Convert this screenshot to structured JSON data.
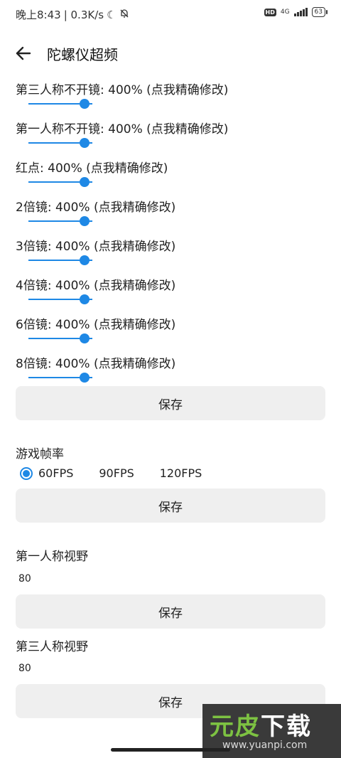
{
  "status": {
    "time": "晚上8:43",
    "speed": "| 0.3K/s",
    "network": "4G",
    "battery": "63"
  },
  "header": {
    "title": "陀螺仪超频"
  },
  "sliders": [
    {
      "label": "第三人称不开镜: 400% (点我精确修改)",
      "value_percent": 400
    },
    {
      "label": "第一人称不开镜: 400% (点我精确修改)",
      "value_percent": 400
    },
    {
      "label": "红点: 400% (点我精确修改)",
      "value_percent": 400
    },
    {
      "label": "2倍镜: 400% (点我精确修改)",
      "value_percent": 400
    },
    {
      "label": "3倍镜: 400% (点我精确修改)",
      "value_percent": 400
    },
    {
      "label": "4倍镜: 400% (点我精确修改)",
      "value_percent": 400
    },
    {
      "label": "6倍镜: 400% (点我精确修改)",
      "value_percent": 400
    },
    {
      "label": "8倍镜: 400% (点我精确修改)",
      "value_percent": 400
    }
  ],
  "save_label": "保存",
  "fps": {
    "label": "游戏帧率",
    "options": [
      "60FPS",
      "90FPS",
      "120FPS"
    ],
    "selected": "60FPS"
  },
  "fov_first": {
    "label": "第一人称视野",
    "value": "80"
  },
  "fov_third": {
    "label": "第三人称视野",
    "value": "80"
  },
  "watermark": {
    "logo_a": "元",
    "logo_b": "皮",
    "logo_c": "下载",
    "url": "www.yuanpi.com"
  },
  "colors": {
    "accent": "#1e88e5",
    "button_bg": "#efefef"
  }
}
